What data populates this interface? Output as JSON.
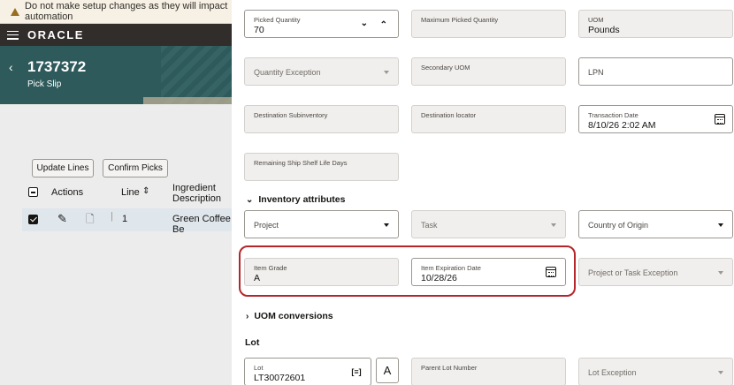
{
  "warning": {
    "text": "Do not make setup changes as they will impact automation"
  },
  "app": {
    "logo": "ORACLE"
  },
  "header": {
    "id": "1737372",
    "subtitle": "Pick Slip"
  },
  "toolbar": {
    "update_lines": "Update Lines",
    "confirm_picks": "Confirm Picks"
  },
  "table": {
    "headers": {
      "actions": "Actions",
      "line": "Line",
      "ingredient": "Ingredient",
      "description": "Description"
    },
    "rows": [
      {
        "line": "1",
        "ingredient": "Green Coffee Be",
        "selected": true
      }
    ]
  },
  "form": {
    "picked_quantity": {
      "label": "Picked Quantity",
      "value": "70"
    },
    "max_picked_quantity": {
      "label": "Maximum Picked Quantity",
      "value": ""
    },
    "uom": {
      "label": "UOM",
      "value": "Pounds"
    },
    "quantity_exception": {
      "placeholder": "Quantity Exception"
    },
    "secondary_uom": {
      "label": "Secondary UOM",
      "value": ""
    },
    "lpn": {
      "placeholder": "LPN"
    },
    "destination_subinventory": {
      "label": "Destination Subinventory",
      "value": ""
    },
    "destination_locator": {
      "label": "Destination locator",
      "value": ""
    },
    "transaction_date": {
      "label": "Transaction Date",
      "value": "8/10/26 2:02 AM"
    },
    "remaining_shelf_life": {
      "label": "Remaining Ship Shelf Life Days",
      "value": ""
    }
  },
  "inventory_attributes": {
    "title": "Inventory attributes",
    "project": {
      "placeholder": "Project"
    },
    "task": {
      "placeholder": "Task"
    },
    "country_of_origin": {
      "placeholder": "Country of Origin"
    },
    "item_grade": {
      "label": "Item Grade",
      "value": "A"
    },
    "item_expiration_date": {
      "label": "Item Expiration Date",
      "value": "10/28/26"
    },
    "project_task_exception": {
      "placeholder": "Project or Task Exception"
    }
  },
  "uom_conversions": {
    "title": "UOM conversions"
  },
  "lot": {
    "title": "Lot",
    "lot": {
      "label": "Lot",
      "value": "LT30072601"
    },
    "parent_lot": {
      "label": "Parent Lot Number",
      "value": ""
    },
    "lot_exception": {
      "placeholder": "Lot Exception"
    },
    "format_button": "A"
  },
  "colors": {
    "highlight": "#b5262b",
    "topbar": "#312d2a",
    "hero": "#2e5a5b"
  }
}
